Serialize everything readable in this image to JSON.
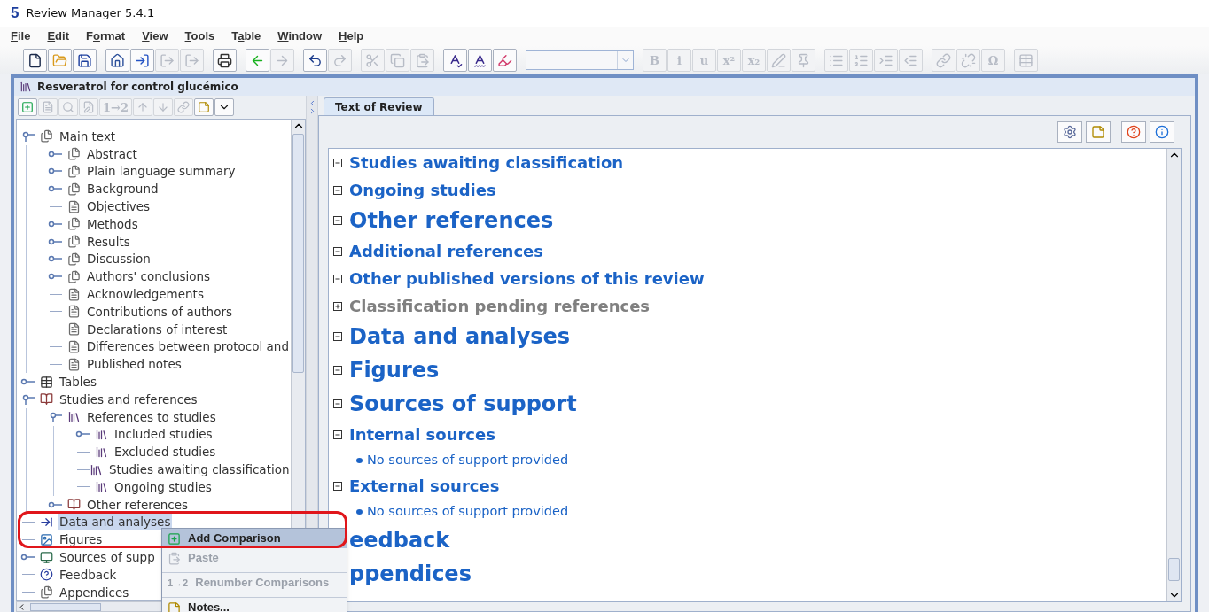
{
  "app": {
    "logo": "5",
    "title": "Review Manager 5.4.1"
  },
  "menu": [
    {
      "label": "File"
    },
    {
      "label": "Edit"
    },
    {
      "label": "Format"
    },
    {
      "label": "View"
    },
    {
      "label": "Tools"
    },
    {
      "label": "Table"
    },
    {
      "label": "Window"
    },
    {
      "label": "Help"
    }
  ],
  "toolbar": [
    [
      {
        "disabled": false
      },
      {
        "disabled": false
      },
      {
        "disabled": false
      }
    ],
    [
      {
        "disabled": false
      },
      {
        "disabled": false
      },
      {
        "disabled": true
      },
      {
        "disabled": true
      }
    ],
    [
      {
        "disabled": false
      }
    ],
    [
      {
        "disabled": false
      },
      {
        "disabled": true
      }
    ],
    [
      {
        "disabled": false
      },
      {
        "disabled": true
      }
    ],
    [
      {
        "disabled": true
      },
      {
        "disabled": true
      },
      {
        "disabled": true
      }
    ],
    [
      {
        "disabled": false
      },
      {
        "disabled": false
      },
      {
        "disabled": false
      }
    ]
  ],
  "style_combo": {
    "disabled": true
  },
  "format_toolbar": [
    [
      {
        "label": "B",
        "disabled": true
      },
      {
        "label": "i",
        "disabled": true
      },
      {
        "label": "u",
        "disabled": true
      },
      {
        "label": "x²",
        "disabled": true
      },
      {
        "label": "x₂",
        "disabled": true
      },
      {
        "disabled": true
      },
      {
        "disabled": true
      }
    ],
    [
      {
        "disabled": true
      },
      {
        "disabled": true
      },
      {
        "disabled": true
      },
      {
        "disabled": true
      }
    ],
    [
      {
        "disabled": true
      },
      {
        "disabled": true
      },
      {
        "label": "Ω",
        "disabled": true
      }
    ],
    [
      {
        "disabled": true
      }
    ]
  ],
  "document": {
    "title": "Resveratrol for control glucémico"
  },
  "tree_toolbar": [
    {
      "disabled": false
    },
    {
      "disabled": true
    },
    {
      "disabled": true
    },
    {
      "disabled": true
    },
    {
      "label": "1→2",
      "disabled": true
    },
    {
      "disabled": true
    },
    {
      "disabled": true
    },
    {
      "disabled": true
    },
    {
      "disabled": false
    },
    {
      "disabled": false
    }
  ],
  "tree": [
    {
      "label": "Main text",
      "kind": "stack",
      "expanded": true,
      "selected": false,
      "children": [
        {
          "label": "Abstract",
          "kind": "stack",
          "expanded": false,
          "selected": false
        },
        {
          "label": "Plain language summary",
          "kind": "stack",
          "expanded": false,
          "selected": false
        },
        {
          "label": "Background",
          "kind": "stack",
          "expanded": false,
          "selected": false
        },
        {
          "label": "Objectives",
          "kind": "doc",
          "selected": false
        },
        {
          "label": "Methods",
          "kind": "stack",
          "expanded": false,
          "selected": false
        },
        {
          "label": "Results",
          "kind": "stack",
          "expanded": false,
          "selected": false
        },
        {
          "label": "Discussion",
          "kind": "stack",
          "expanded": false,
          "selected": false
        },
        {
          "label": "Authors' conclusions",
          "kind": "stack",
          "expanded": false,
          "selected": false
        },
        {
          "label": "Acknowledgements",
          "kind": "doc",
          "selected": false
        },
        {
          "label": "Contributions of authors",
          "kind": "doc",
          "selected": false
        },
        {
          "label": "Declarations of interest",
          "kind": "doc",
          "selected": false
        },
        {
          "label": "Differences between protocol and",
          "kind": "doc",
          "selected": false
        },
        {
          "label": "Published notes",
          "kind": "doc",
          "selected": false
        }
      ]
    },
    {
      "label": "Tables",
      "kind": "table",
      "expanded": false,
      "selected": false
    },
    {
      "label": "Studies and references",
      "kind": "book",
      "expanded": true,
      "selected": false,
      "children": [
        {
          "label": "References to studies",
          "kind": "refs",
          "expanded": true,
          "selected": false,
          "children": [
            {
              "label": "Included studies",
              "kind": "refs",
              "expanded": false,
              "selected": false
            },
            {
              "label": "Excluded studies",
              "kind": "refs",
              "selected": false
            },
            {
              "label": "Studies awaiting classification",
              "kind": "refs",
              "selected": false
            },
            {
              "label": "Ongoing studies",
              "kind": "refs",
              "selected": false
            }
          ]
        },
        {
          "label": "Other references",
          "kind": "book",
          "expanded": false,
          "selected": false
        }
      ]
    },
    {
      "label": "Data and analyses",
      "kind": "data",
      "selected": true
    },
    {
      "label": "Figures",
      "kind": "figure",
      "selected": false
    },
    {
      "label": "Sources of supp",
      "kind": "sources",
      "expanded": false,
      "selected": false
    },
    {
      "label": "Feedback",
      "kind": "feedback",
      "selected": false
    },
    {
      "label": "Appendices",
      "kind": "stack",
      "selected": false
    }
  ],
  "context_menu": [
    {
      "kind": "add",
      "label": "Add Comparison",
      "disabled": false,
      "selected": true
    },
    {
      "kind": "paste",
      "label": "Paste",
      "disabled": true,
      "selected": false
    },
    {
      "kind": "separator"
    },
    {
      "kind": "plain",
      "prefix": "1→2",
      "label": "Renumber Comparisons",
      "disabled": true,
      "selected": false
    },
    {
      "kind": "separator"
    },
    {
      "kind": "notes",
      "label": "Notes...",
      "disabled": false,
      "selected": false
    }
  ],
  "tabs": [
    {
      "label": "Text of Review",
      "selected": true
    }
  ],
  "content": [
    {
      "kind": "subsection",
      "text": "Studies awaiting classification",
      "expanded": true,
      "greyed": false
    },
    {
      "kind": "subsection",
      "text": "Ongoing studies",
      "expanded": true,
      "greyed": false
    },
    {
      "kind": "section",
      "text": "Other references",
      "expanded": true,
      "greyed": false
    },
    {
      "kind": "subsection",
      "text": "Additional references",
      "expanded": true,
      "greyed": false
    },
    {
      "kind": "subsection",
      "text": "Other published versions of this review",
      "expanded": true,
      "greyed": false
    },
    {
      "kind": "subsection",
      "text": "Classification pending references",
      "expanded": false,
      "greyed": true
    },
    {
      "kind": "section",
      "text": "Data and analyses",
      "expanded": true,
      "greyed": false
    },
    {
      "kind": "section",
      "text": "Figures",
      "expanded": true,
      "greyed": false
    },
    {
      "kind": "section",
      "text": "Sources of support",
      "expanded": true,
      "greyed": false
    },
    {
      "kind": "subsection",
      "text": "Internal sources",
      "expanded": true,
      "greyed": false
    },
    {
      "kind": "bullet",
      "text": "No sources of support provided"
    },
    {
      "kind": "subsection",
      "text": "External sources",
      "expanded": true,
      "greyed": false
    },
    {
      "kind": "bullet",
      "text": "No sources of support provided"
    },
    {
      "kind": "section",
      "text": "eedback",
      "greyed": false
    },
    {
      "kind": "section",
      "text": "ppendices",
      "greyed": false
    }
  ]
}
